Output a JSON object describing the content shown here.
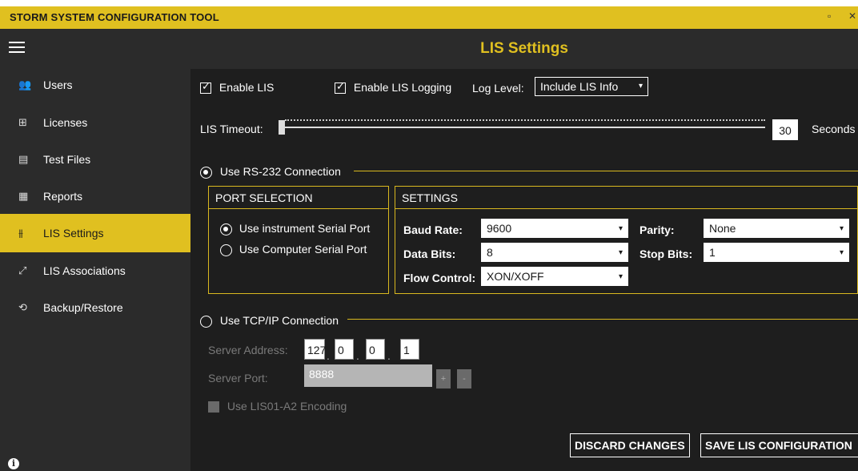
{
  "app": {
    "title": "STORM SYSTEM CONFIGURATION TOOL",
    "maximize_glyph": "▫",
    "close_glyph": "✕"
  },
  "sidebar": {
    "items": [
      {
        "label": "Users",
        "icon": "users-icon",
        "glyph": "👥"
      },
      {
        "label": "Licenses",
        "icon": "licenses-icon",
        "glyph": "⊞"
      },
      {
        "label": "Test Files",
        "icon": "file-icon",
        "glyph": "▤"
      },
      {
        "label": "Reports",
        "icon": "report-icon",
        "glyph": "▦"
      },
      {
        "label": "LIS Settings",
        "icon": "sliders-icon",
        "glyph": "⫵",
        "active": true
      },
      {
        "label": "LIS Associations",
        "icon": "link-icon",
        "glyph": "⤢"
      },
      {
        "label": "Backup/Restore",
        "icon": "restore-icon",
        "glyph": "⟲"
      }
    ],
    "info_glyph": "i"
  },
  "header": {
    "title": "LIS Settings"
  },
  "options": {
    "enable_lis_label": "Enable LIS",
    "enable_lis_checked": true,
    "enable_logging_label": "Enable LIS Logging",
    "enable_logging_checked": true,
    "log_level_label": "Log Level:",
    "log_level_value": "Include LIS Info"
  },
  "timeout": {
    "label": "LIS Timeout:",
    "value": "30",
    "unit": "Seconds",
    "slider_fraction": 0.0
  },
  "rs232": {
    "label": "Use RS-232 Connection",
    "selected": true,
    "port_selection": {
      "header": "PORT SELECTION",
      "options": [
        "Use instrument Serial Port",
        "Use Computer Serial Port"
      ],
      "selected_index": 0
    },
    "settings": {
      "header": "SETTINGS",
      "baud_rate_label": "Baud Rate:",
      "baud_rate_value": "9600",
      "data_bits_label": "Data Bits:",
      "data_bits_value": "8",
      "flow_control_label": "Flow Control:",
      "flow_control_value": "XON/XOFF",
      "parity_label": "Parity:",
      "parity_value": "None",
      "stop_bits_label": "Stop Bits:",
      "stop_bits_value": "1"
    }
  },
  "tcpip": {
    "label": "Use TCP/IP Connection",
    "selected": false,
    "server_address_label": "Server Address:",
    "ip_octets": [
      "127",
      "0",
      "0",
      "1"
    ],
    "ip_separator": ".",
    "server_port_label": "Server Port:",
    "server_port_value": "8888",
    "increment_label": "+",
    "decrement_label": "-",
    "encoding_label": "Use LIS01-A2 Encoding",
    "encoding_checked": false
  },
  "actions": {
    "discard_label": "DISCARD CHANGES",
    "save_label": "SAVE LIS CONFIGURATION"
  },
  "colors": {
    "accent": "#e0c020",
    "background": "#1e1e1e",
    "sidebar": "#2b2b2b"
  }
}
